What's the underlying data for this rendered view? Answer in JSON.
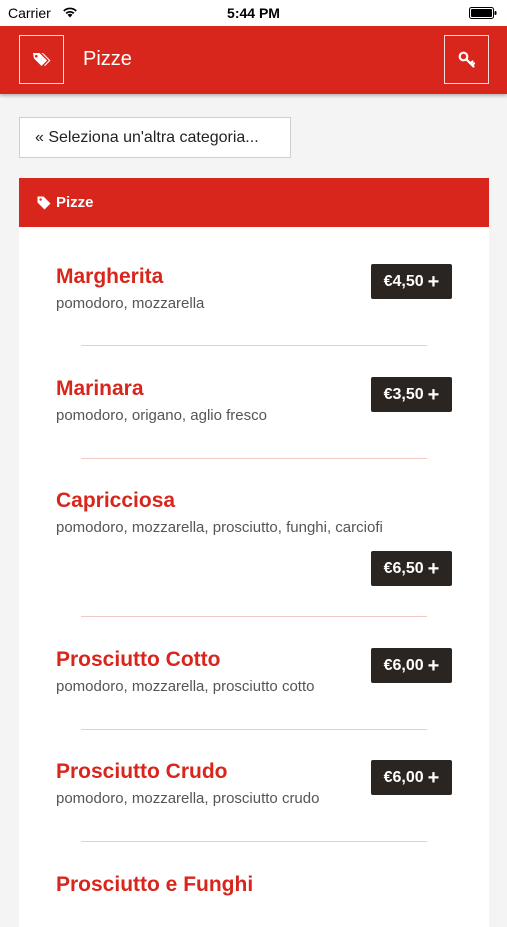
{
  "status_bar": {
    "carrier": "Carrier",
    "time": "5:44 PM"
  },
  "header": {
    "title": "Pizze",
    "left_icon": "tags-icon",
    "right_icon": "key-icon"
  },
  "back_button": {
    "label": "« Seleziona un'altra categoria..."
  },
  "category": {
    "title": "Pizze",
    "icon": "tag-icon"
  },
  "colors": {
    "primary": "#d9261c",
    "price_button": "#2a2520",
    "divider": "#f1c9c5"
  },
  "items": [
    {
      "name": "Margherita",
      "description": "pomodoro, mozzarella",
      "price": "€4,50"
    },
    {
      "name": "Marinara",
      "description": "pomodoro, origano, aglio fresco",
      "price": "€3,50"
    },
    {
      "name": "Capricciosa",
      "description": "pomodoro, mozzarella, prosciutto, funghi, carciofi",
      "price": "€6,50"
    },
    {
      "name": "Prosciutto Cotto",
      "description": "pomodoro, mozzarella, prosciutto cotto",
      "price": "€6,00"
    },
    {
      "name": "Prosciutto Crudo",
      "description": "pomodoro, mozzarella, prosciutto crudo",
      "price": "€6,00"
    },
    {
      "name": "Prosciutto e Funghi"
    }
  ]
}
